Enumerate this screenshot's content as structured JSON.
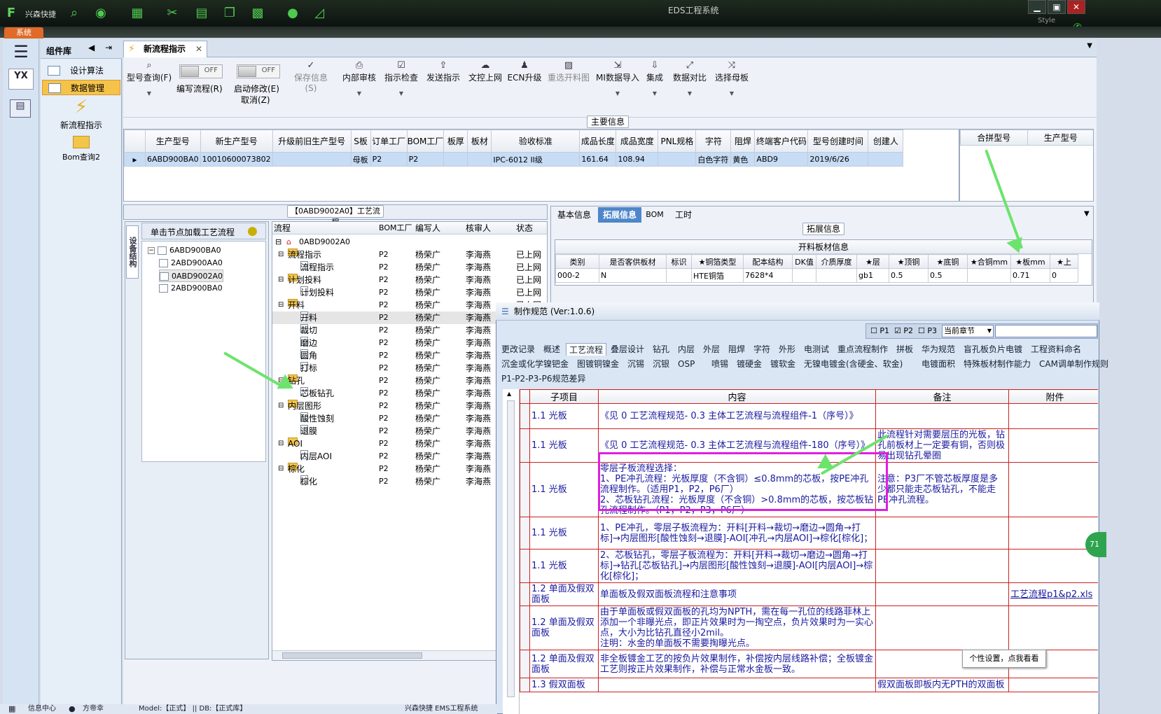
{
  "app": {
    "title": "EDS工程系统",
    "quick_label": "兴森快捷",
    "sys_tab": "系统",
    "style_label": "Style"
  },
  "left_panel": {
    "logo_text": "YX",
    "component_lib": "组件库",
    "items": [
      "设计算法",
      "数据管理"
    ],
    "big_items": [
      "新流程指示",
      "Bom查询2"
    ]
  },
  "doc_tab": "新流程指示",
  "toolbar": {
    "model_query": "型号查询(F)",
    "edit_flow": "编写流程(R)",
    "auto_modify": "启动修改(E)",
    "cancel": "取消(Z)",
    "switch_off": "OFF",
    "items": [
      "保存信息(S)",
      "内部审核",
      "指示检查",
      "发送指示",
      "文控上网",
      "ECN升级",
      "重选开料图",
      "MI数据导入",
      "集成",
      "数据对比",
      "选择母板"
    ]
  },
  "main_info": {
    "header": "主要信息",
    "columns": [
      "生产型号",
      "新生产型号",
      "升级前旧生产型号",
      "S板",
      "订单工厂",
      "BOM工厂",
      "板厚",
      "板材",
      "验收标准",
      "成品长度",
      "成品宽度",
      "PNL规格",
      "字符",
      "阻焊",
      "终端客户代码",
      "型号创建时间",
      "创建人"
    ],
    "row": [
      "6ABD900BA0",
      "10010600073802",
      "",
      "母板",
      "P2",
      "P2",
      "",
      "",
      "IPC-6012 II级",
      "161.64",
      "108.94",
      "",
      "白色字符",
      "黄色",
      "ABD9",
      "2019/6/26",
      ""
    ],
    "merge_columns": [
      "合拼型号",
      "生产型号"
    ]
  },
  "process_tree": {
    "header": "【0ABD9002A0】工艺流程",
    "vertical_tab": "设备结构",
    "hint": "单击节点加载工艺流程",
    "nodes": [
      "6ABD900BA0",
      "2ABD900AA0",
      "0ABD9002A0",
      "2ABD900BA0"
    ]
  },
  "flow": {
    "columns": [
      "流程",
      "BOM工厂",
      "编写人",
      "核审人",
      "状态"
    ],
    "root": "0ABD9002A0",
    "rows": [
      {
        "name": "流程指示",
        "level": 1,
        "folder": true,
        "bom": "P2",
        "writer": "杨荣广",
        "reviewer": "李海燕",
        "status": "已上网"
      },
      {
        "name": "流程指示",
        "level": 2,
        "folder": false,
        "bom": "P2",
        "writer": "杨荣广",
        "reviewer": "李海燕",
        "status": "已上网"
      },
      {
        "name": "计划投料",
        "level": 1,
        "folder": true,
        "bom": "P2",
        "writer": "杨荣广",
        "reviewer": "李海燕",
        "status": "已上网"
      },
      {
        "name": "计划投料",
        "level": 2,
        "folder": false,
        "bom": "P2",
        "writer": "杨荣广",
        "reviewer": "李海燕",
        "status": "已上网"
      },
      {
        "name": "开料",
        "level": 1,
        "folder": true,
        "bom": "P2",
        "writer": "杨荣广",
        "reviewer": "李海燕",
        "status": "已上网"
      },
      {
        "name": "开料",
        "level": 2,
        "folder": false,
        "bom": "P2",
        "writer": "杨荣广",
        "reviewer": "李海燕",
        "status": "已上网"
      },
      {
        "name": "裁切",
        "level": 2,
        "folder": false,
        "bom": "P2",
        "writer": "杨荣广",
        "reviewer": "李海燕",
        "status": "已上网"
      },
      {
        "name": "磨边",
        "level": 2,
        "folder": false,
        "bom": "P2",
        "writer": "杨荣广",
        "reviewer": "李海燕",
        "status": "已上网"
      },
      {
        "name": "圆角",
        "level": 2,
        "folder": false,
        "bom": "P2",
        "writer": "杨荣广",
        "reviewer": "李海燕",
        "status": "已上网"
      },
      {
        "name": "打标",
        "level": 2,
        "folder": false,
        "bom": "P2",
        "writer": "杨荣广",
        "reviewer": "李海燕",
        "status": "已上网"
      },
      {
        "name": "钻孔",
        "level": 1,
        "folder": true,
        "bom": "P2",
        "writer": "杨荣广",
        "reviewer": "李海燕",
        "status": "已上网"
      },
      {
        "name": "芯板钻孔",
        "level": 2,
        "folder": false,
        "bom": "P2",
        "writer": "杨荣广",
        "reviewer": "李海燕",
        "status": "已上网"
      },
      {
        "name": "内层图形",
        "level": 1,
        "folder": true,
        "bom": "P2",
        "writer": "杨荣广",
        "reviewer": "李海燕",
        "status": "已上网"
      },
      {
        "name": "酸性蚀刻",
        "level": 2,
        "folder": false,
        "bom": "P2",
        "writer": "杨荣广",
        "reviewer": "李海燕",
        "status": "已上网"
      },
      {
        "name": "退膜",
        "level": 2,
        "folder": false,
        "bom": "P2",
        "writer": "杨荣广",
        "reviewer": "李海燕",
        "status": "已上网"
      },
      {
        "name": "AOI",
        "level": 1,
        "folder": true,
        "bom": "P2",
        "writer": "杨荣广",
        "reviewer": "李海燕",
        "status": "已上网"
      },
      {
        "name": "内层AOI",
        "level": 2,
        "folder": false,
        "bom": "P2",
        "writer": "杨荣广",
        "reviewer": "李海燕",
        "status": "已上网"
      },
      {
        "name": "棕化",
        "level": 1,
        "folder": true,
        "bom": "P2",
        "writer": "杨荣广",
        "reviewer": "李海燕",
        "status": "已上网"
      },
      {
        "name": "棕化",
        "level": 2,
        "folder": false,
        "bom": "P2",
        "writer": "杨荣广",
        "reviewer": "李海燕",
        "status": "已上网"
      }
    ]
  },
  "right_tabs": [
    "基本信息",
    "拓展信息",
    "BOM",
    "工时"
  ],
  "ext_info": {
    "header": "拓展信息",
    "sub_header": "开料板材信息",
    "columns": [
      "类别",
      "是否客供板材",
      "标识",
      "★铜箔类型",
      "配本结构",
      "DK值",
      "介质厚度",
      "★层",
      "★顶铜",
      "★底铜",
      "★合铜mm",
      "★板mm",
      "★上"
    ],
    "row": [
      "000-2",
      "N",
      "",
      "HTE铜箔",
      "7628*4",
      "",
      "",
      "gb1",
      "0.5",
      "0.5",
      "",
      "0.71",
      "0"
    ]
  },
  "spec": {
    "title": "制作规范 (Ver:1.0.6)",
    "filter": {
      "p1": "P1",
      "p2": "P2",
      "p3": "P3",
      "scope": "当前章节"
    },
    "tabs1": [
      "更改记录",
      "概述",
      "工艺流程",
      "叠层设计",
      "钻孔",
      "内层",
      "外层",
      "阻焊",
      "字符",
      "外形",
      "电测试",
      "重点流程制作",
      "拼板",
      "华为规范",
      "盲孔板负片电镀",
      "工程资料命名"
    ],
    "tabs2": [
      "沉金或化学镍钯金",
      "图镀铜镍金",
      "沉锡",
      "沉银",
      "OSP",
      "喷锡",
      "镀硬金",
      "镀软金",
      "无镍电镀金(含硬金、软金)",
      "电镀面积",
      "特殊板材制作能力",
      "CAM调单制作规则"
    ],
    "tabs3": [
      "P1-P2-P3-P6规范差异"
    ],
    "columns": [
      "子项目",
      "内容",
      "备注",
      "附件"
    ],
    "rows": [
      {
        "item": "1.1 光板",
        "content": "《见 0 工艺流程规范- 0.3 主体工艺流程与流程组件-1（序号）》",
        "note": "",
        "attach": ""
      },
      {
        "item": "1.1 光板",
        "content": "《见 0 工艺流程规范- 0.3 主体工艺流程与流程组件-180（序号）》",
        "note": "此流程针对需要层压的光板，钻孔前板材上一定要有铜，否则极易出现钻孔晕圈",
        "attach": ""
      },
      {
        "item": "1.1 光板",
        "content": "零层子板流程选择：\n1、PE冲孔流程：光板厚度（不含铜）≤0.8mm的芯板，按PE冲孔流程制作。（适用P1，P2，P6厂）\n2、芯板钻孔流程：光板厚度（不含铜）>0.8mm的芯板，按芯板钻孔流程制作。（P1，P2，P3，P6厂）",
        "note": "注意：P3厂不管芯板厚度是多少都只能走芯板钻孔，不能走PE冲孔流程。",
        "attach": ""
      },
      {
        "item": "1.1 光板",
        "content": "1、PE冲孔，零层子板流程为：开料[开料→裁切→磨边→圆角→打标]→内层图形[酸性蚀刻→退膜]-AOI[冲孔→内层AOI]→棕化[棕化]；",
        "note": "",
        "attach": ""
      },
      {
        "item": "1.1 光板",
        "content": "2、芯板钻孔，零层子板流程为：开料[开料→裁切→磨边→圆角→打标]→钻孔[芯板钻孔]→内层图形[酸性蚀刻→退膜]-AOI[内层AOI]→棕化[棕化]；",
        "note": "",
        "attach": ""
      },
      {
        "item": "1.2 单面及假双面板",
        "content": "单面板及假双面板流程和注意事项",
        "note": "",
        "attach": "工艺流程p1&p2.xls"
      },
      {
        "item": "1.2 单面及假双面板",
        "content": "由于单面板或假双面板的孔均为NPTH，需在每一孔位的线路菲林上添加一个非曝光点，即正片效果时为一掏空点，负片效果时为一实心点，大小为比钻孔直径小2mil。\n注明：水金的单面板不需要掏曝光点。",
        "note": "",
        "attach": ""
      },
      {
        "item": "1.2 单面及假双面板",
        "content": "非全板镀金工艺的按负片效果制作，补偿按内层线路补偿；全板镀金工艺则按正片效果制作，补偿与正常水金板一致。",
        "note": "",
        "attach": ""
      },
      {
        "item": "1.3 假双面板",
        "content": "",
        "note": "假双面板即板内无PTH的双面板",
        "attach": ""
      }
    ]
  },
  "tooltip": "个性设置，点我看看",
  "badge": "71",
  "status": {
    "info_center": "信息中心",
    "user": "方帝幸",
    "model": "Model:【正式】 || DB:【正式库】",
    "system": "兴森快捷 EMS工程系统"
  }
}
